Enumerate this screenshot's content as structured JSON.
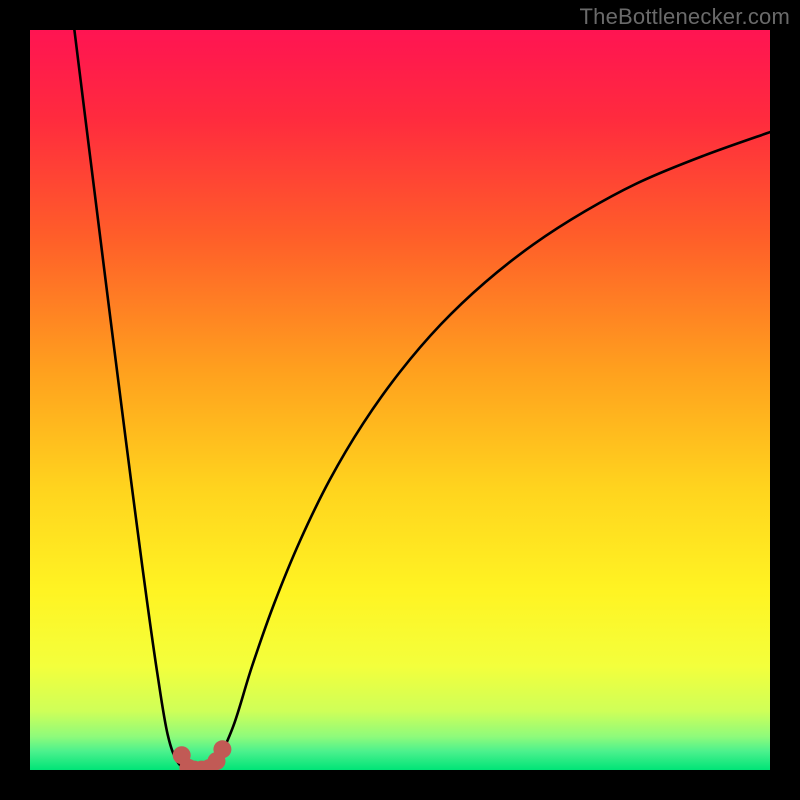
{
  "watermark": "TheBottlenecker.com",
  "chart_data": {
    "type": "line",
    "title": "",
    "xlabel": "",
    "ylabel": "",
    "xlim": [
      0,
      1
    ],
    "ylim": [
      0,
      1
    ],
    "gradient_stops": [
      {
        "offset": 0.0,
        "color": "#ff1452"
      },
      {
        "offset": 0.12,
        "color": "#ff2b3e"
      },
      {
        "offset": 0.28,
        "color": "#ff5e29"
      },
      {
        "offset": 0.46,
        "color": "#ffa01e"
      },
      {
        "offset": 0.62,
        "color": "#ffd41e"
      },
      {
        "offset": 0.76,
        "color": "#fff423"
      },
      {
        "offset": 0.86,
        "color": "#f3ff3c"
      },
      {
        "offset": 0.92,
        "color": "#cfff58"
      },
      {
        "offset": 0.955,
        "color": "#8efb7b"
      },
      {
        "offset": 0.975,
        "color": "#4bf18d"
      },
      {
        "offset": 1.0,
        "color": "#00e477"
      }
    ],
    "series": [
      {
        "name": "left-branch",
        "x": [
          0.06,
          0.074,
          0.088,
          0.102,
          0.116,
          0.13,
          0.144,
          0.158,
          0.172,
          0.186,
          0.2,
          0.214
        ],
        "y": [
          1.0,
          0.887,
          0.775,
          0.663,
          0.552,
          0.442,
          0.334,
          0.229,
          0.131,
          0.048,
          0.01,
          0.003
        ]
      },
      {
        "name": "right-branch",
        "x": [
          0.25,
          0.275,
          0.3,
          0.33,
          0.365,
          0.405,
          0.45,
          0.5,
          0.555,
          0.615,
          0.68,
          0.75,
          0.825,
          0.91,
          1.0
        ],
        "y": [
          0.003,
          0.06,
          0.14,
          0.225,
          0.31,
          0.392,
          0.468,
          0.538,
          0.602,
          0.659,
          0.71,
          0.755,
          0.795,
          0.83,
          0.862
        ]
      }
    ],
    "markers": {
      "name": "valley-markers",
      "note": "approximate marker positions at valley floor",
      "color": "#c15a55",
      "radius_px": 9,
      "points": [
        {
          "x": 0.205,
          "y": 0.02
        },
        {
          "x": 0.214,
          "y": 0.003
        },
        {
          "x": 0.222,
          "y": 0.0005
        },
        {
          "x": 0.232,
          "y": 0.0005
        },
        {
          "x": 0.242,
          "y": 0.0025
        },
        {
          "x": 0.252,
          "y": 0.012
        },
        {
          "x": 0.26,
          "y": 0.028
        }
      ]
    }
  }
}
